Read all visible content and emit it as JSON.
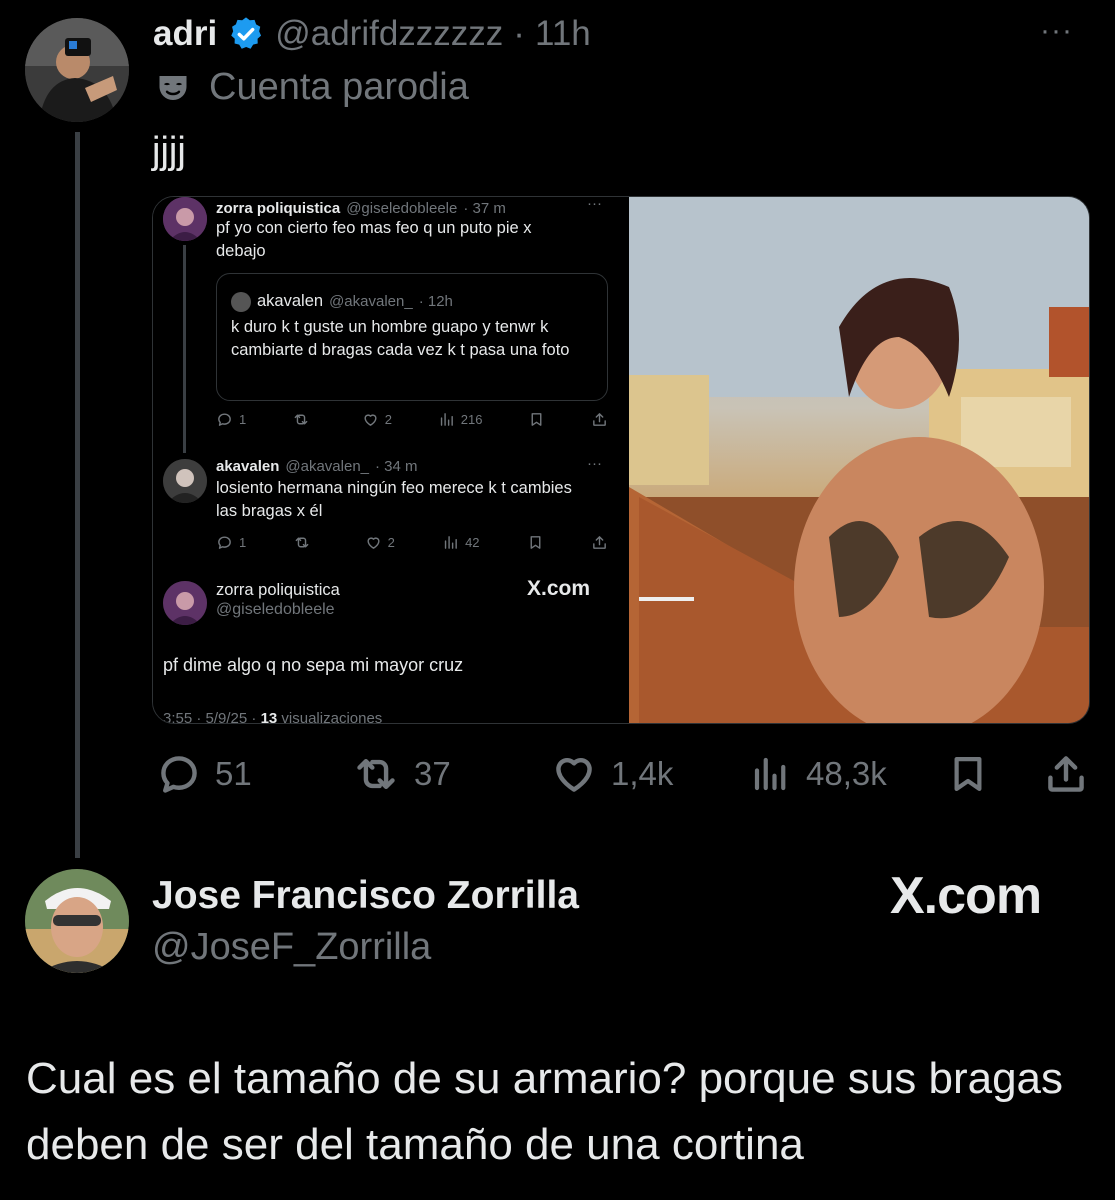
{
  "tweet": {
    "name": "adri",
    "handle": "@adrifdzzzzzz",
    "sep": "·",
    "time": "11h",
    "more": "···",
    "label_icon": "mask-icon",
    "label": "Cuenta parodia",
    "text": "jjjj",
    "stats": {
      "replies": "51",
      "reposts": "37",
      "likes": "1,4k",
      "views": "48,3k"
    }
  },
  "embed": {
    "t1": {
      "name": "zorra poliquistica",
      "handle": "@giseledobleele",
      "time": "· 37 m",
      "more": "···",
      "text": "pf yo con cierto feo mas feo q un puto pie x debajo"
    },
    "quote": {
      "name": "akavalen",
      "handle": "@akavalen_",
      "time": "· 12h",
      "text": "k duro k t guste un hombre guapo y tenwr k cambiarte d bragas cada vez k t pasa una foto"
    },
    "t1_stats": {
      "replies": "1",
      "reposts": "",
      "likes": "2",
      "views": "216"
    },
    "t2": {
      "name": "akavalen",
      "handle": "@akavalen_",
      "time": "· 34 m",
      "more": "···",
      "text": "losiento hermana ningún feo merece k t cambies las bragas x él"
    },
    "t2_stats": {
      "replies": "1",
      "reposts": "",
      "likes": "2",
      "views": "42"
    },
    "t3": {
      "name": "zorra poliquistica",
      "handle": "@giseledobleele",
      "brand": "X.com",
      "text": "pf dime algo q no sepa mi mayor cruz",
      "meta_time": "3:55 · 5/9/25 · ",
      "meta_views": "13",
      "meta_views_label": " visualizaciones"
    }
  },
  "reply": {
    "name": "Jose Francisco Zorrilla",
    "handle": "@JoseF_Zorrilla",
    "brand": "X.com",
    "text": "Cual es el tamaño de su armario? porque sus bragas deben de ser del tamaño de una cortina"
  },
  "colors": {
    "background": "#000000",
    "text": "#e7e9ea",
    "muted": "#71767b",
    "verified": "#1d9bf0",
    "border": "#2f3336"
  }
}
